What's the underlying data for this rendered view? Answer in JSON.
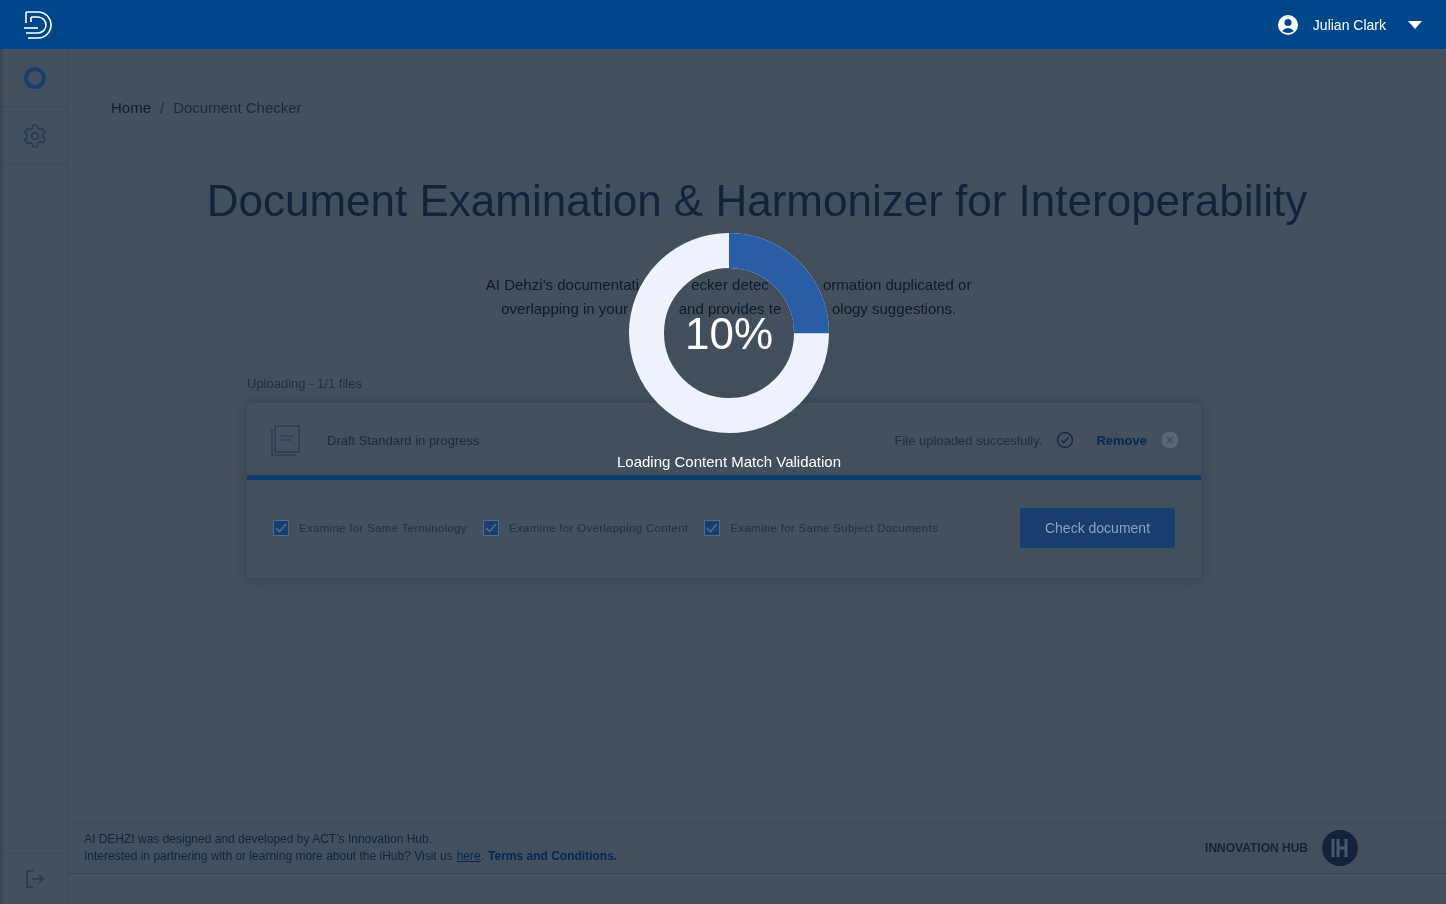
{
  "header": {
    "user_name": "Julian Clark"
  },
  "breadcrumb": {
    "items": [
      "Home",
      "Document Checker"
    ],
    "separator": "/"
  },
  "title": "Document Examination & Harmonizer for Interoperability",
  "description": [
    [
      "AI Dehzi’s documentati",
      "ecker detec",
      "ormation duplicated or"
    ],
    [
      "overlapping in your",
      "and provides te",
      "ology suggestions."
    ]
  ],
  "upload": {
    "label": "Uploading - 1/1 files",
    "file_name": "Draft Standard in progress",
    "status": "File uploaded succesfully.",
    "remove": "Remove",
    "level": 1
  },
  "options": [
    {
      "label": "Examine for Same Terminology",
      "checked": true
    },
    {
      "label": "Examine for Overlapping Content",
      "checked": true
    },
    {
      "label": "Examine for Same Subject Documents",
      "checked": true
    }
  ],
  "check_button": "Check document",
  "loader": {
    "reading": "10%",
    "level": 0.25,
    "message": "Loading Content Match Validation"
  },
  "footer": {
    "line1": "AI DEHZI was designed and developed by ACT’s Innovation Hub.",
    "line2": "Interested in partnering with or learning more about the iHub? Visit us",
    "link": "here",
    "period": ".",
    "terms": "Terms and Conditions.",
    "brand": "INNOVATION HUB"
  }
}
